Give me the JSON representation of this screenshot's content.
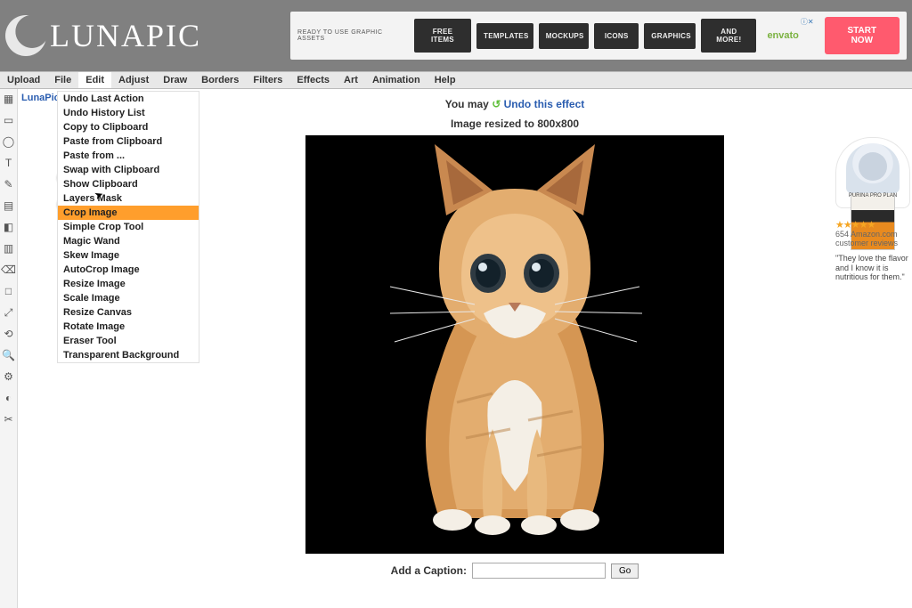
{
  "brand": {
    "name": "LUNAPIC"
  },
  "header_ad": {
    "title": "READY TO USE GRAPHIC ASSETS",
    "tiles": [
      "FREE ITEMS",
      "TEMPLATES",
      "MOCKUPS",
      "ICONS",
      "GRAPHICS",
      "AND MORE!"
    ],
    "brand": "envato",
    "cta": "START NOW"
  },
  "menubar": [
    "Upload",
    "File",
    "Edit",
    "Adjust",
    "Draw",
    "Borders",
    "Filters",
    "Effects",
    "Art",
    "Animation",
    "Help"
  ],
  "active_menu_index": 2,
  "side_label": "LunaPic >",
  "edit_menu": [
    "Undo Last Action",
    "Undo History List",
    "Copy to Clipboard",
    "Paste from Clipboard",
    "Paste from ...",
    "Swap with Clipboard",
    "Show Clipboard",
    "Layers Mask",
    "Crop Image",
    "Simple Crop Tool",
    "Magic Wand",
    "Skew Image",
    "AutoCrop Image",
    "Resize Image",
    "Scale Image",
    "Resize Canvas",
    "Rotate Image",
    "Eraser Tool",
    "Transparent Background"
  ],
  "highlight_index": 8,
  "tools": [
    "▦",
    "▭",
    "◯",
    "T",
    "✎",
    "▤",
    "◧",
    "▥",
    "⌫",
    "□",
    "⤢",
    "⟲",
    "🔍",
    "⚙",
    "◐",
    "✂"
  ],
  "main": {
    "undo_prefix": "You may ",
    "undo_link": "Undo this effect",
    "resize_text": "Image resized to 800x800",
    "caption_label": "Add a Caption:",
    "caption_value": "",
    "go_label": "Go"
  },
  "right_ad": {
    "pack_brand": "PURINA PRO PLAN",
    "stars": "★★★★★",
    "review_count": "654 Amazon.com customer reviews",
    "quote": "\"They love the flavor and I know it is nutritious for them.\""
  }
}
